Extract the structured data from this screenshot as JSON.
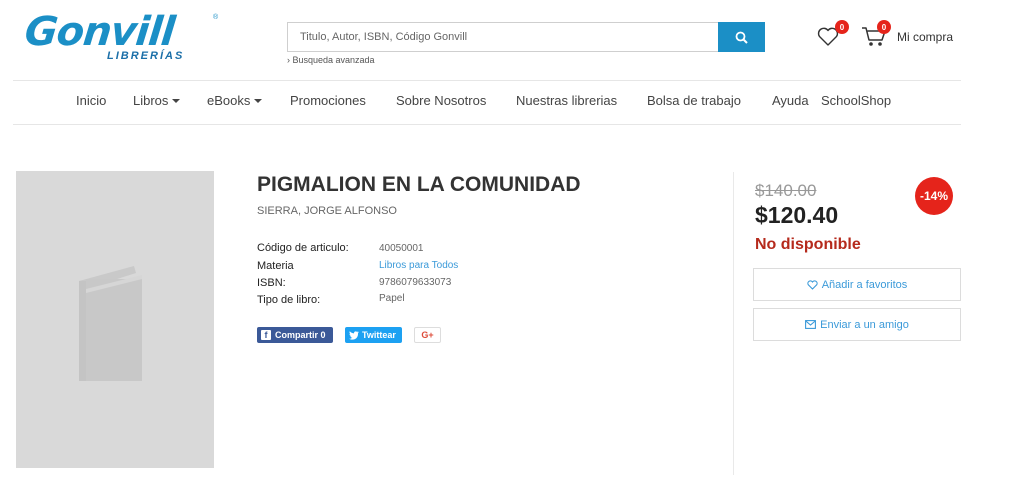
{
  "brand": {
    "name": "Gonvill",
    "subtitle": "LIBRERÍAS",
    "mark": "®",
    "color": "#1b8fc6"
  },
  "search": {
    "placeholder": "Titulo, Autor, ISBN, Código Gonvill",
    "advanced_link": "› Busqueda avanzada",
    "icon": "search-icon"
  },
  "header": {
    "favorites_count": "0",
    "cart_count": "0",
    "cart_label": "Mi compra"
  },
  "nav": {
    "items": [
      {
        "label": "Inicio"
      },
      {
        "label": "Libros",
        "dropdown": true
      },
      {
        "label": "eBooks",
        "dropdown": true
      },
      {
        "label": "Promociones"
      },
      {
        "label": "Sobre Nosotros"
      },
      {
        "label": "Nuestras librerias"
      },
      {
        "label": "Bolsa de trabajo"
      },
      {
        "label": "Ayuda"
      },
      {
        "label": "SchoolShop"
      }
    ]
  },
  "product": {
    "title": "PIGMALION EN LA COMUNIDAD",
    "author": "SIERRA, JORGE ALFONSO",
    "details": [
      {
        "label": "Código de articulo:",
        "value": "40050001"
      },
      {
        "label": "Materia",
        "value": "Libros para Todos",
        "link": true
      },
      {
        "label": "ISBN:",
        "value": "9786079633073"
      },
      {
        "label": "Tipo de libro:",
        "value": "Papel"
      }
    ],
    "cover_icon": "book-icon"
  },
  "share": {
    "facebook": "Compartir 0",
    "twitter": "Twittear",
    "google": "G+"
  },
  "pricing": {
    "old_price": "$140.00",
    "price": "$120.40",
    "availability": "No disponible",
    "discount": "-14%",
    "add_favorites": "Añadir a favoritos",
    "send_friend": "Enviar a un amigo"
  },
  "colors": {
    "accent": "#1b8fc6",
    "badge": "#e5241b",
    "unavailable": "#b52a1c",
    "link": "#3b9ad9"
  }
}
